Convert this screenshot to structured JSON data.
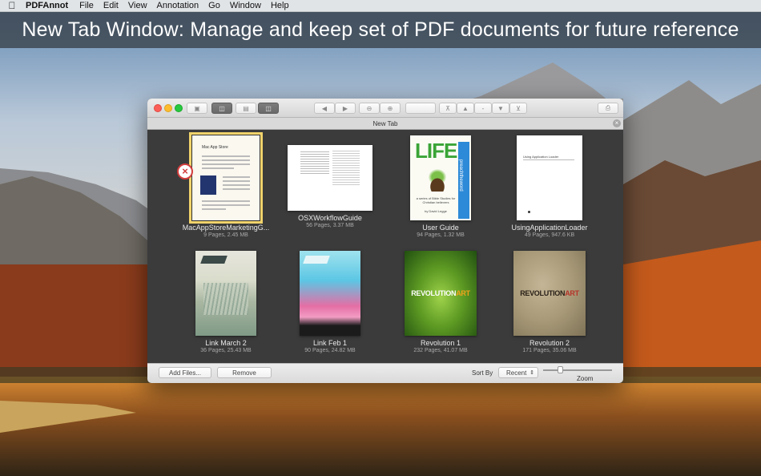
{
  "menubar": {
    "app_name": "PDFAnnot",
    "items": [
      "File",
      "Edit",
      "View",
      "Annotation",
      "Go",
      "Window",
      "Help"
    ]
  },
  "banner": {
    "text": "New Tab Window: Manage and keep set of PDF documents for future reference"
  },
  "window": {
    "tab_title": "New Tab",
    "documents": [
      {
        "title": "MacAppStoreMarketingG...",
        "meta": "9 Pages, 2.45 MB",
        "selected": true
      },
      {
        "title": "OSXWorkflowGuide",
        "meta": "56 Pages, 3.37 MB"
      },
      {
        "title": "User Guide",
        "meta": "94 Pages, 1.32 MB"
      },
      {
        "title": "UsingApplicationLoader",
        "meta": "49 Pages, 947.6 KB"
      },
      {
        "title": "Link March 2",
        "meta": "36 Pages, 25.43 MB"
      },
      {
        "title": "Link Feb 1",
        "meta": "90 Pages, 24.82 MB"
      },
      {
        "title": "Revolution 1",
        "meta": "232 Pages, 41.07 MB"
      },
      {
        "title": "Revolution 2",
        "meta": "171 Pages, 35.06 MB"
      }
    ],
    "cover_text": {
      "appstore_heading": "Mac App Store",
      "life": "LIFE",
      "life_side": "preachtheword",
      "life_sub": "a series of Bible Studies for Christian believers",
      "life_author": "by David Legge",
      "loader_heading": "Using Application Loader",
      "revolution_a": "REVOLUTION",
      "revolution_b": "ART"
    },
    "bottom": {
      "add_files": "Add Files...",
      "remove": "Remove",
      "sort_by_label": "Sort By",
      "sort_value": "Recent",
      "zoom_label": "Zoom"
    }
  },
  "colors": {
    "selection": "#f1d36b",
    "delete_badge": "#d23d3d"
  }
}
